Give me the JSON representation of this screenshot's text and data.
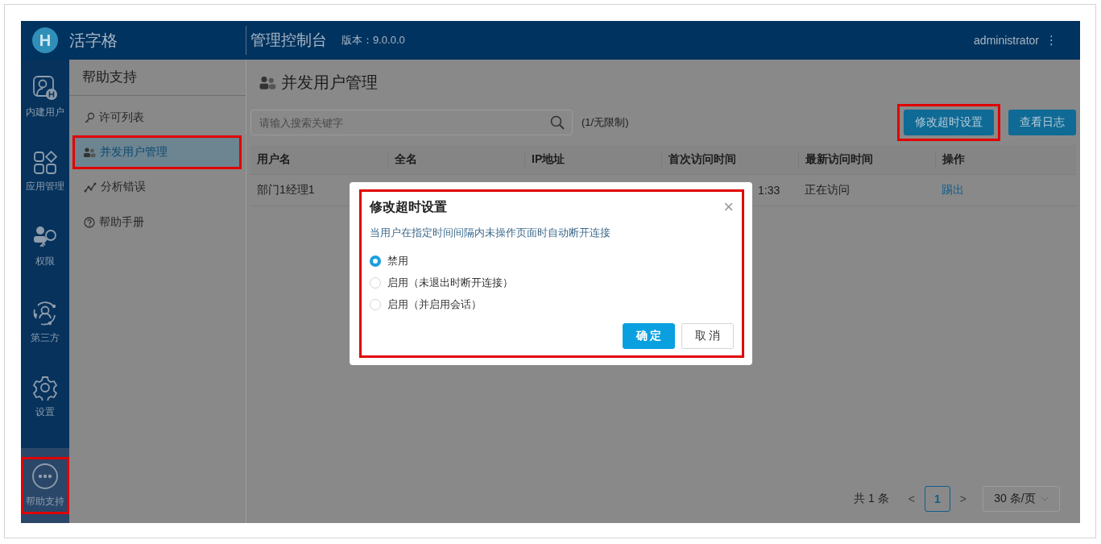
{
  "header": {
    "logo_letter": "H",
    "brand": "活字格",
    "title": "管理控制台",
    "version": "版本：9.0.0.0",
    "user": "administrator",
    "menu_glyph": "⋮"
  },
  "nav_rail": [
    {
      "label": "内建用户",
      "selected": false,
      "highlighted": false
    },
    {
      "label": "应用管理",
      "selected": false,
      "highlighted": false
    },
    {
      "label": "权限",
      "selected": false,
      "highlighted": false
    },
    {
      "label": "第三方",
      "selected": false,
      "highlighted": false
    },
    {
      "label": "设置",
      "selected": false,
      "highlighted": false
    },
    {
      "label": "帮助支持",
      "selected": true,
      "highlighted": true
    }
  ],
  "sidebar": {
    "title": "帮助支持",
    "items": [
      {
        "label": "许可列表",
        "selected": false,
        "highlighted": false
      },
      {
        "label": "并发用户管理",
        "selected": true,
        "highlighted": true
      },
      {
        "label": "分析错误",
        "selected": false,
        "highlighted": false
      },
      {
        "label": "帮助手册",
        "selected": false,
        "highlighted": false
      }
    ]
  },
  "page": {
    "title": "并发用户管理",
    "search": {
      "placeholder": "请输入搜索关键字"
    },
    "count": "(1/无限制)",
    "buttons": [
      {
        "label": "修改超时设置",
        "highlighted": true
      },
      {
        "label": "查看日志",
        "highlighted": false
      }
    ]
  },
  "table": {
    "columns": [
      "用户名",
      "全名",
      "IP地址",
      "首次访问时间",
      "最新访问时间",
      "操作"
    ],
    "rows": [
      [
        {
          "text": "部门1经理1"
        },
        {},
        {},
        {
          "text": "1:33"
        },
        {
          "text": "正在访问"
        },
        {
          "text": "踢出",
          "kind": "link"
        }
      ]
    ]
  },
  "pagination": {
    "total": "共 1 条",
    "prev": "<",
    "pages": [
      {
        "label": "1",
        "selected": true
      }
    ],
    "next": ">",
    "page_size": "30 条/页"
  },
  "dialog": {
    "title": "修改超时设置",
    "highlighted": true,
    "close": "×",
    "description": "当用户在指定时间间隔内未操作页面时自动断开连接",
    "options": [
      {
        "label": "禁用",
        "selected": true
      },
      {
        "label": "启用（未退出时断开连接）",
        "selected": false
      },
      {
        "label": "启用（并启用会话）",
        "selected": false
      }
    ],
    "buttons": [
      {
        "label": "确 定",
        "kind": "primary"
      },
      {
        "label": "取 消",
        "kind": "default"
      }
    ]
  }
}
